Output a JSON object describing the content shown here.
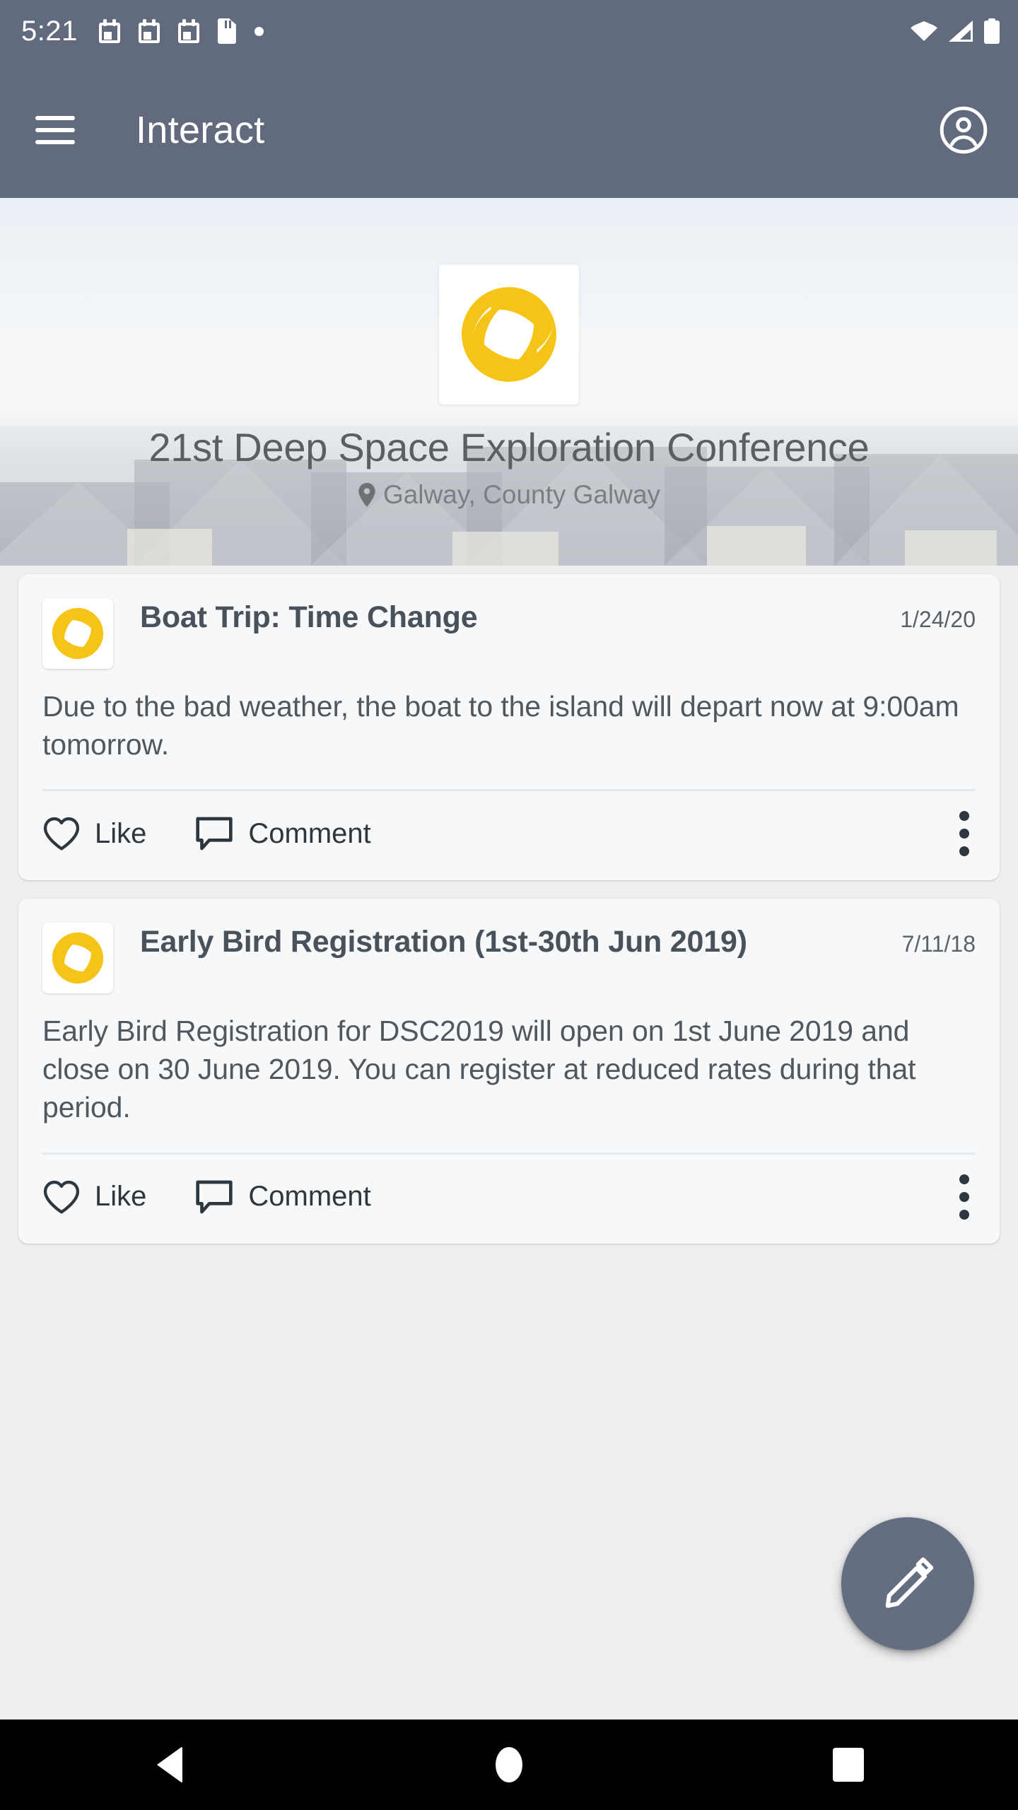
{
  "status_bar": {
    "time": "5:21",
    "left_icons": [
      "calendar-icon",
      "calendar-icon",
      "calendar-icon",
      "sd-card-icon",
      "dot-icon"
    ],
    "right_icons": [
      "wifi-icon",
      "cell-signal-icon",
      "battery-icon"
    ]
  },
  "app_bar": {
    "menu_icon": "hamburger-menu-icon",
    "title": "Interact",
    "account_icon": "account-circle-icon"
  },
  "hero": {
    "logo_icon": "conference-logo",
    "title": "21st Deep Space Exploration Conference",
    "location_icon": "location-pin-icon",
    "location": "Galway, County Galway"
  },
  "feed": {
    "posts": [
      {
        "thumb_icon": "conference-logo",
        "title": "Boat Trip: Time Change",
        "date": "1/24/20",
        "body": "Due to the bad weather, the boat to the island will depart now at 9:00am tomorrow.",
        "like_label": "Like",
        "comment_label": "Comment",
        "like_icon": "heart-outline-icon",
        "comment_icon": "speech-bubble-icon",
        "overflow_icon": "more-vertical-icon"
      },
      {
        "thumb_icon": "conference-logo",
        "title": "Early Bird Registration (1st-30th Jun 2019)",
        "date": "7/11/18",
        "body": "Early Bird Registration for DSC2019 will open on 1st June 2019 and close on 30 June 2019. You can register at reduced rates during that period.",
        "like_label": "Like",
        "comment_label": "Comment",
        "like_icon": "heart-outline-icon",
        "comment_icon": "speech-bubble-icon",
        "overflow_icon": "more-vertical-icon"
      }
    ]
  },
  "fab": {
    "icon": "pencil-edit-icon"
  },
  "nav_bar": {
    "back_icon": "back-triangle-icon",
    "home_icon": "home-circle-icon",
    "recents_icon": "recents-square-icon"
  },
  "colors": {
    "app_bar": "#626a7d",
    "page_bg": "#eceef0",
    "card_bg": "#f7f8fa",
    "logo_yellow": "#f6c417",
    "fab": "#656d80",
    "nav_bar": "#000000"
  }
}
